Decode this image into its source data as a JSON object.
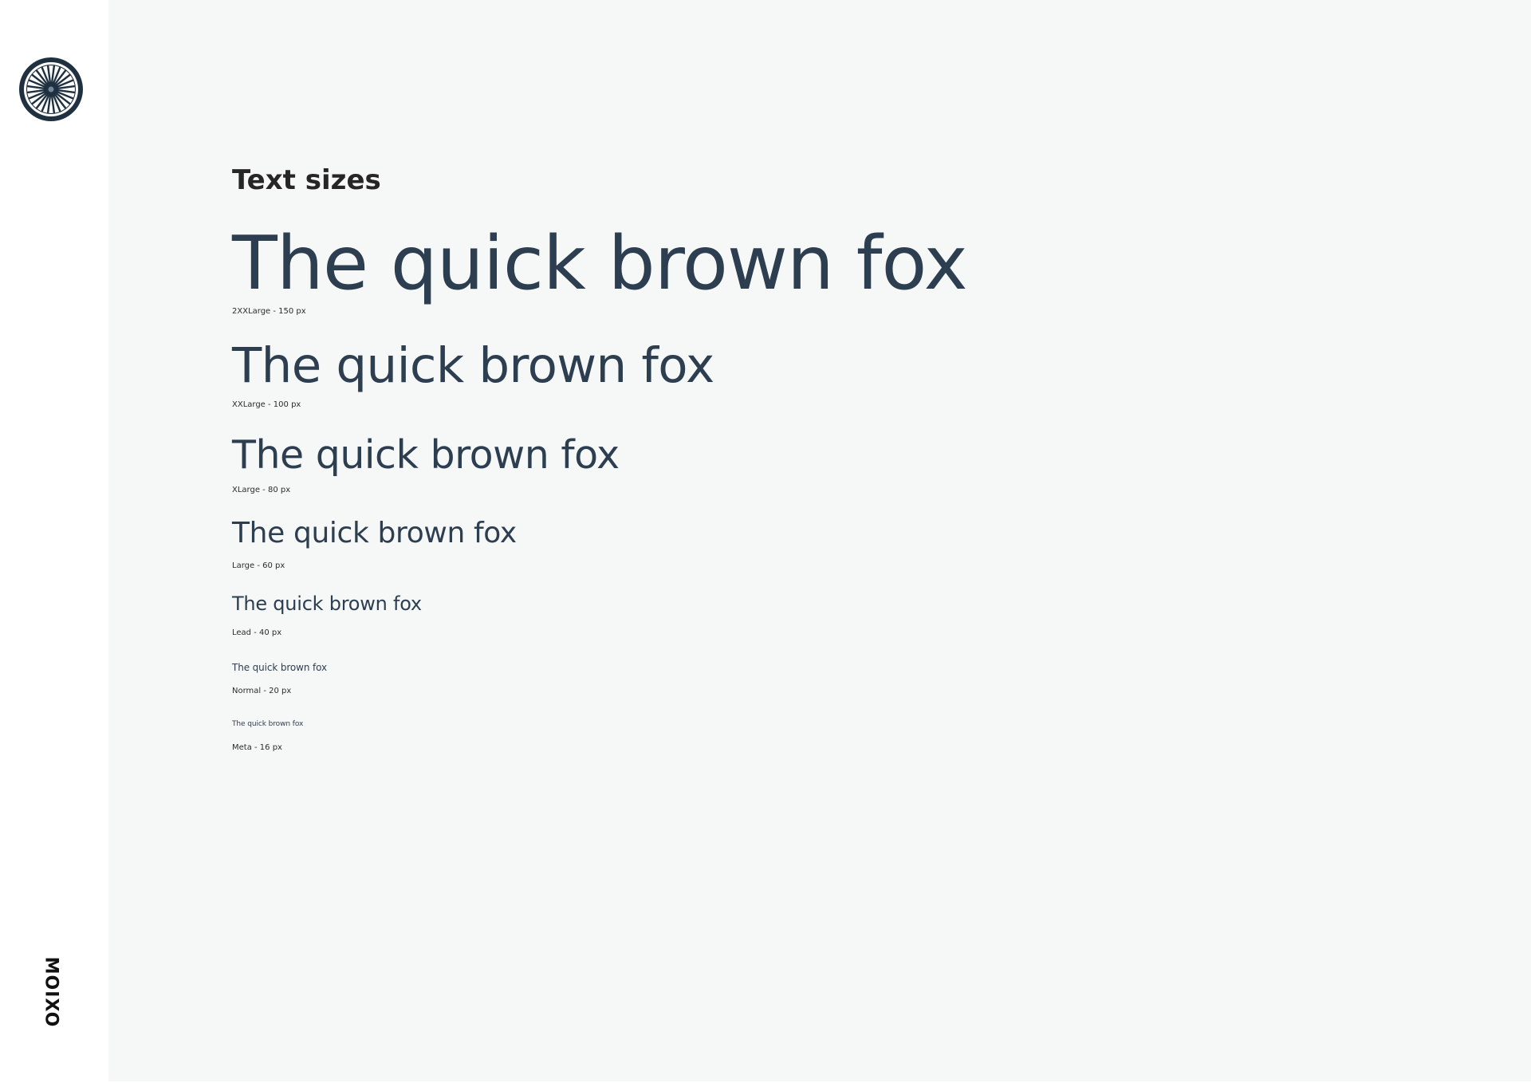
{
  "brand": {
    "name": "MOIXO"
  },
  "icons": {
    "logo": "dharma-wheel-icon"
  },
  "colors": {
    "sample_text": "#2d3e50",
    "page_background": "#f6f8f8",
    "sidebar_background": "#ffffff"
  },
  "section": {
    "title": "Text sizes"
  },
  "samples": [
    {
      "text": "The quick brown fox",
      "caption": "2XXLarge - 150 px"
    },
    {
      "text": "The quick brown fox",
      "caption": "XXLarge - 100 px"
    },
    {
      "text": "The quick brown fox",
      "caption": "XLarge - 80 px"
    },
    {
      "text": "The quick brown fox",
      "caption": "Large - 60 px"
    },
    {
      "text": "The quick brown fox",
      "caption": "Lead - 40 px"
    },
    {
      "text": "The quick brown fox",
      "caption": "Normal - 20 px"
    },
    {
      "text": "The quick brown fox",
      "caption": "Meta - 16 px"
    }
  ]
}
